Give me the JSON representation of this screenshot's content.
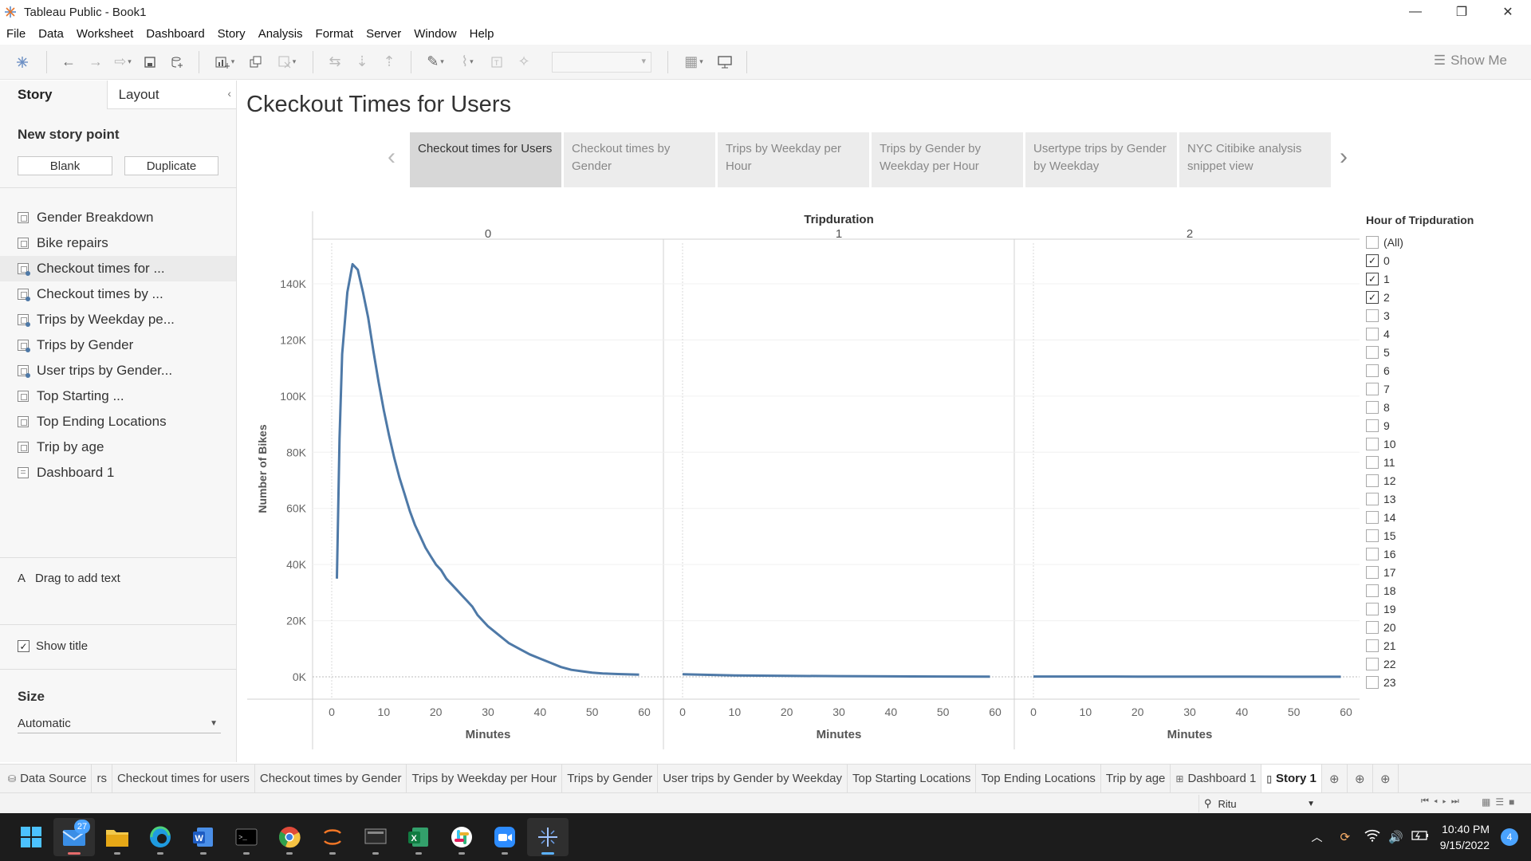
{
  "window": {
    "title": "Tableau Public - Book1",
    "buttons": [
      "minimize",
      "restore",
      "close"
    ]
  },
  "menu": [
    "File",
    "Data",
    "Worksheet",
    "Dashboard",
    "Story",
    "Analysis",
    "Format",
    "Server",
    "Window",
    "Help"
  ],
  "toolbar": {
    "show_me": "Show Me"
  },
  "story_pane": {
    "tab_story": "Story",
    "tab_layout": "Layout",
    "new_story_point": "New story point",
    "blank_label": "Blank",
    "duplicate_label": "Duplicate",
    "sheets": [
      {
        "label": "Gender Breakdown",
        "type": "sheet",
        "used": false
      },
      {
        "label": "Bike repairs",
        "type": "sheet",
        "used": false
      },
      {
        "label": "Checkout times for ...",
        "type": "sheet",
        "used": true
      },
      {
        "label": "Checkout times by ...",
        "type": "sheet",
        "used": true
      },
      {
        "label": "Trips by Weekday pe...",
        "type": "sheet",
        "used": true
      },
      {
        "label": "Trips by Gender",
        "type": "sheet",
        "used": true
      },
      {
        "label": "User trips by Gender...",
        "type": "sheet",
        "used": true
      },
      {
        "label": "Top Starting ...",
        "type": "sheet",
        "used": false
      },
      {
        "label": "Top Ending Locations",
        "type": "sheet",
        "used": false
      },
      {
        "label": "Trip by age",
        "type": "sheet",
        "used": false
      },
      {
        "label": "Dashboard 1",
        "type": "dashboard",
        "used": false
      }
    ],
    "drag_text": "Drag to add text",
    "show_title": "Show title",
    "size_title": "Size",
    "size_value": "Automatic"
  },
  "story": {
    "title": "Ckeckout Times for Users",
    "points": [
      "Checkout times for Users",
      "Checkout times by Gender",
      "Trips by Weekday per Hour",
      "Trips by Gender by Weekday per Hour",
      "Usertype trips by Gender by Weekday",
      "NYC Citibike analysis snippet view"
    ],
    "active_point": 0
  },
  "chart_data": {
    "type": "line",
    "title": "",
    "column_header": "Tripduration",
    "panels": [
      "0",
      "1",
      "2"
    ],
    "xlabel": "Minutes",
    "ylabel": "Number of Bikes",
    "xlim": [
      0,
      60
    ],
    "xticks": [
      0,
      10,
      20,
      30,
      40,
      50,
      60
    ],
    "ylim": [
      0,
      150000
    ],
    "yticks": [
      0,
      20000,
      40000,
      60000,
      80000,
      100000,
      120000,
      140000
    ],
    "ytick_labels": [
      "0K",
      "20K",
      "40K",
      "60K",
      "80K",
      "100K",
      "120K",
      "140K"
    ],
    "color": "#4e79a7",
    "series": [
      {
        "panel": "0",
        "x": [
          1,
          1.5,
          2,
          3,
          4,
          5,
          6,
          7,
          8,
          9,
          10,
          11,
          12,
          13,
          14,
          15,
          16,
          17,
          18,
          19,
          20,
          21,
          22,
          23,
          24,
          25,
          26,
          27,
          28,
          29,
          30,
          32,
          34,
          36,
          38,
          40,
          42,
          44,
          46,
          48,
          50,
          52,
          55,
          59
        ],
        "y": [
          35000,
          85000,
          115000,
          137000,
          147000,
          145000,
          137000,
          128000,
          116000,
          105000,
          95000,
          86000,
          78000,
          71000,
          65000,
          59000,
          54000,
          50000,
          46000,
          43000,
          40000,
          38000,
          35000,
          33000,
          31000,
          29000,
          27000,
          25000,
          22000,
          20000,
          18000,
          15000,
          12000,
          10000,
          8000,
          6500,
          5000,
          3500,
          2500,
          2000,
          1500,
          1200,
          1000,
          800
        ]
      },
      {
        "panel": "1",
        "x": [
          0,
          5,
          10,
          20,
          30,
          40,
          50,
          59
        ],
        "y": [
          900,
          700,
          500,
          350,
          250,
          180,
          120,
          80
        ]
      },
      {
        "panel": "2",
        "x": [
          0,
          10,
          20,
          30,
          40,
          50,
          59
        ],
        "y": [
          120,
          100,
          80,
          60,
          50,
          40,
          30
        ]
      }
    ]
  },
  "filter": {
    "title": "Hour of Tripduration",
    "items": [
      {
        "label": "(All)",
        "checked": false
      },
      {
        "label": "0",
        "checked": true
      },
      {
        "label": "1",
        "checked": true
      },
      {
        "label": "2",
        "checked": true
      },
      {
        "label": "3",
        "checked": false
      },
      {
        "label": "4",
        "checked": false
      },
      {
        "label": "5",
        "checked": false
      },
      {
        "label": "6",
        "checked": false
      },
      {
        "label": "7",
        "checked": false
      },
      {
        "label": "8",
        "checked": false
      },
      {
        "label": "9",
        "checked": false
      },
      {
        "label": "10",
        "checked": false
      },
      {
        "label": "11",
        "checked": false
      },
      {
        "label": "12",
        "checked": false
      },
      {
        "label": "13",
        "checked": false
      },
      {
        "label": "14",
        "checked": false
      },
      {
        "label": "15",
        "checked": false
      },
      {
        "label": "16",
        "checked": false
      },
      {
        "label": "17",
        "checked": false
      },
      {
        "label": "18",
        "checked": false
      },
      {
        "label": "19",
        "checked": false
      },
      {
        "label": "20",
        "checked": false
      },
      {
        "label": "21",
        "checked": false
      },
      {
        "label": "22",
        "checked": false
      },
      {
        "label": "23",
        "checked": false
      }
    ]
  },
  "sheet_tabs": [
    {
      "label": "Data Source",
      "icon": "database-icon"
    },
    {
      "label": "rs"
    },
    {
      "label": "Checkout times for users"
    },
    {
      "label": "Checkout times by Gender"
    },
    {
      "label": "Trips by Weekday per Hour"
    },
    {
      "label": "Trips by Gender"
    },
    {
      "label": "User trips by Gender by Weekday"
    },
    {
      "label": "Top Starting Locations"
    },
    {
      "label": "Top Ending Locations"
    },
    {
      "label": "Trip by age"
    },
    {
      "label": "Dashboard 1",
      "icon": "dashboard-icon"
    },
    {
      "label": "Story 1",
      "icon": "story-icon",
      "active": true
    }
  ],
  "status": {
    "user": "Ritu"
  },
  "taskbar": {
    "mail_badge": "27",
    "time": "10:40 PM",
    "date": "9/15/2022",
    "notifications": "4"
  }
}
